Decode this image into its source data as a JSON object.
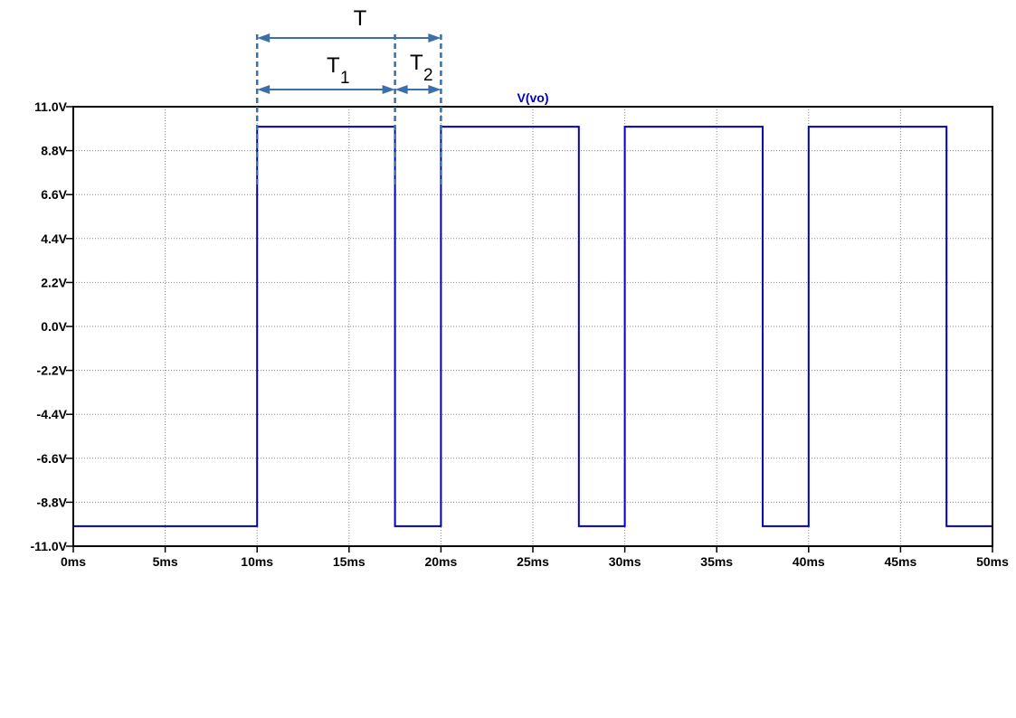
{
  "chart_data": {
    "type": "line",
    "title": "",
    "xlabel": "",
    "ylabel": "",
    "xlim": [
      0,
      50
    ],
    "ylim": [
      -11.0,
      11.0
    ],
    "x_unit": "ms",
    "x_ticks": [
      "0ms",
      "5ms",
      "10ms",
      "15ms",
      "20ms",
      "25ms",
      "30ms",
      "35ms",
      "40ms",
      "45ms",
      "50ms"
    ],
    "x_tick_values": [
      0,
      5,
      10,
      15,
      20,
      25,
      30,
      35,
      40,
      45,
      50
    ],
    "y_ticks": [
      "11.0V",
      "8.8V",
      "6.6V",
      "4.4V",
      "2.2V",
      "0.0V",
      "-2.2V",
      "-4.4V",
      "-6.6V",
      "-8.8V",
      "-11.0V"
    ],
    "y_tick_values": [
      11.0,
      8.8,
      6.6,
      4.4,
      2.2,
      0.0,
      -2.2,
      -4.4,
      -6.6,
      -8.8,
      -11.0
    ],
    "grid": true,
    "series": [
      {
        "name": "V(vo)",
        "color": "#0000bb",
        "x": [
          0,
          10,
          10,
          17.5,
          17.5,
          20,
          20,
          27.5,
          27.5,
          30,
          30,
          37.5,
          37.5,
          40,
          40,
          47.5,
          47.5,
          50
        ],
        "y": [
          -10,
          -10,
          10,
          10,
          -10,
          -10,
          10,
          10,
          -10,
          -10,
          10,
          10,
          -10,
          -10,
          10,
          10,
          -10,
          -10
        ]
      }
    ],
    "annotations": {
      "color": "#3a6fa8",
      "period": {
        "label": "T",
        "x_start": 10,
        "x_end": 20
      },
      "t1": {
        "label": "T",
        "sub": "1",
        "x_start": 10,
        "x_end": 17.5
      },
      "t2": {
        "label": "T",
        "sub": "2",
        "x_start": 17.5,
        "x_end": 20
      }
    }
  }
}
